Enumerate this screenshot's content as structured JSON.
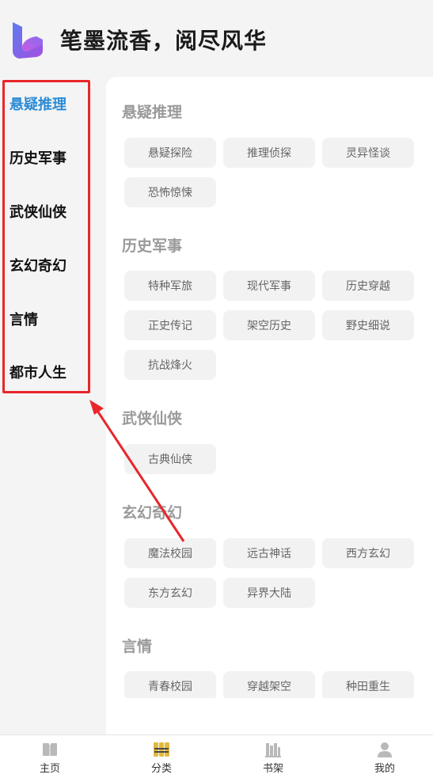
{
  "header": {
    "title": "笔墨流香，阅尽风华",
    "logo_icon": "app-logo-icon"
  },
  "sidebar": {
    "items": [
      {
        "label": "悬疑推理",
        "active": true
      },
      {
        "label": "历史军事",
        "active": false
      },
      {
        "label": "武侠仙侠",
        "active": false
      },
      {
        "label": "玄幻奇幻",
        "active": false
      },
      {
        "label": "言情",
        "active": false
      },
      {
        "label": "都市人生",
        "active": false
      }
    ]
  },
  "sections": [
    {
      "title": "悬疑推理",
      "tags": [
        "悬疑探险",
        "推理侦探",
        "灵异怪谈",
        "恐怖惊悚"
      ]
    },
    {
      "title": "历史军事",
      "tags": [
        "特种军旅",
        "现代军事",
        "历史穿越",
        "正史传记",
        "架空历史",
        "野史细说",
        "抗战烽火"
      ]
    },
    {
      "title": "武侠仙侠",
      "tags": [
        "古典仙侠"
      ]
    },
    {
      "title": "玄幻奇幻",
      "tags": [
        "魔法校园",
        "远古神话",
        "西方玄幻",
        "东方玄幻",
        "异界大陆"
      ]
    },
    {
      "title": "言情",
      "tags": [
        "青春校园",
        "穿越架空",
        "种田重生"
      ]
    }
  ],
  "bottom_nav": [
    {
      "label": "主页",
      "icon": "book-open-icon"
    },
    {
      "label": "分类",
      "icon": "category-icon",
      "active": true
    },
    {
      "label": "书架",
      "icon": "bookshelf-icon"
    },
    {
      "label": "我的",
      "icon": "user-icon"
    }
  ],
  "colors": {
    "accent": "#2b8bd6",
    "annotation": "#e8262a",
    "chip_bg": "#f2f2f2",
    "section_title": "#9a9a9a",
    "nav_active": "#e2b93b"
  }
}
